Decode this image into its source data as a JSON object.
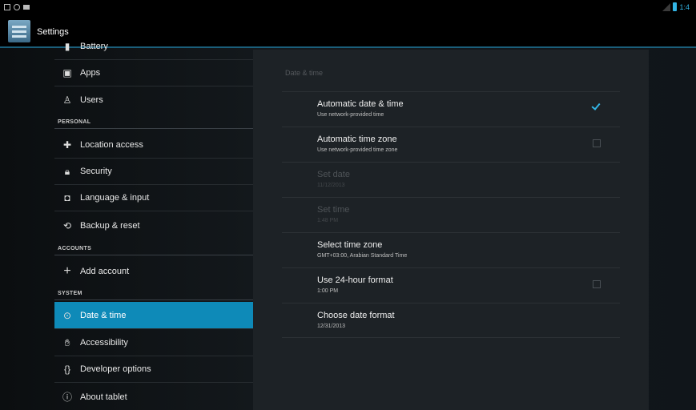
{
  "status_bar": {
    "time": "1:4"
  },
  "action_bar": {
    "title": "Settings"
  },
  "sidebar": {
    "partial_item": {
      "label": "Battery",
      "icon": "battery-icon"
    },
    "items": [
      {
        "label": "Apps",
        "icon": "apps-icon"
      },
      {
        "label": "Users",
        "icon": "users-icon"
      }
    ],
    "personal_header": "PERSONAL",
    "personal_items": [
      {
        "label": "Location access",
        "icon": "location-icon"
      },
      {
        "label": "Security",
        "icon": "lock-icon"
      },
      {
        "label": "Language & input",
        "icon": "keyboard-icon"
      },
      {
        "label": "Backup & reset",
        "icon": "backup-icon"
      }
    ],
    "accounts_header": "ACCOUNTS",
    "accounts_items": [
      {
        "label": "Add account",
        "icon": "plus-icon"
      }
    ],
    "system_header": "SYSTEM",
    "system_items": [
      {
        "label": "Date & time",
        "icon": "clock-icon",
        "selected": true
      },
      {
        "label": "Accessibility",
        "icon": "accessibility-icon"
      },
      {
        "label": "Developer options",
        "icon": "braces-icon"
      },
      {
        "label": "About tablet",
        "icon": "info-icon"
      }
    ]
  },
  "detail": {
    "header": "Date & time",
    "prefs": [
      {
        "title": "Automatic date & time",
        "summary": "Use network-provided time",
        "checkbox": true,
        "checked": true,
        "enabled": true
      },
      {
        "title": "Automatic time zone",
        "summary": "Use network-provided time zone",
        "checkbox": true,
        "checked": false,
        "enabled": true
      },
      {
        "title": "Set date",
        "summary": "11/12/2013",
        "checkbox": false,
        "enabled": false
      },
      {
        "title": "Set time",
        "summary": "1:48 PM",
        "checkbox": false,
        "enabled": false
      },
      {
        "title": "Select time zone",
        "summary": "GMT+03:00, Arabian Standard Time",
        "checkbox": false,
        "enabled": true
      },
      {
        "title": "Use 24-hour format",
        "summary": "1:00 PM",
        "checkbox": true,
        "checked": false,
        "enabled": true
      },
      {
        "title": "Choose date format",
        "summary": "12/31/2013",
        "checkbox": false,
        "enabled": true
      }
    ]
  },
  "colors": {
    "accent": "#33b5e5",
    "selected_row": "#0e8ab8",
    "background": "#1d2226"
  }
}
